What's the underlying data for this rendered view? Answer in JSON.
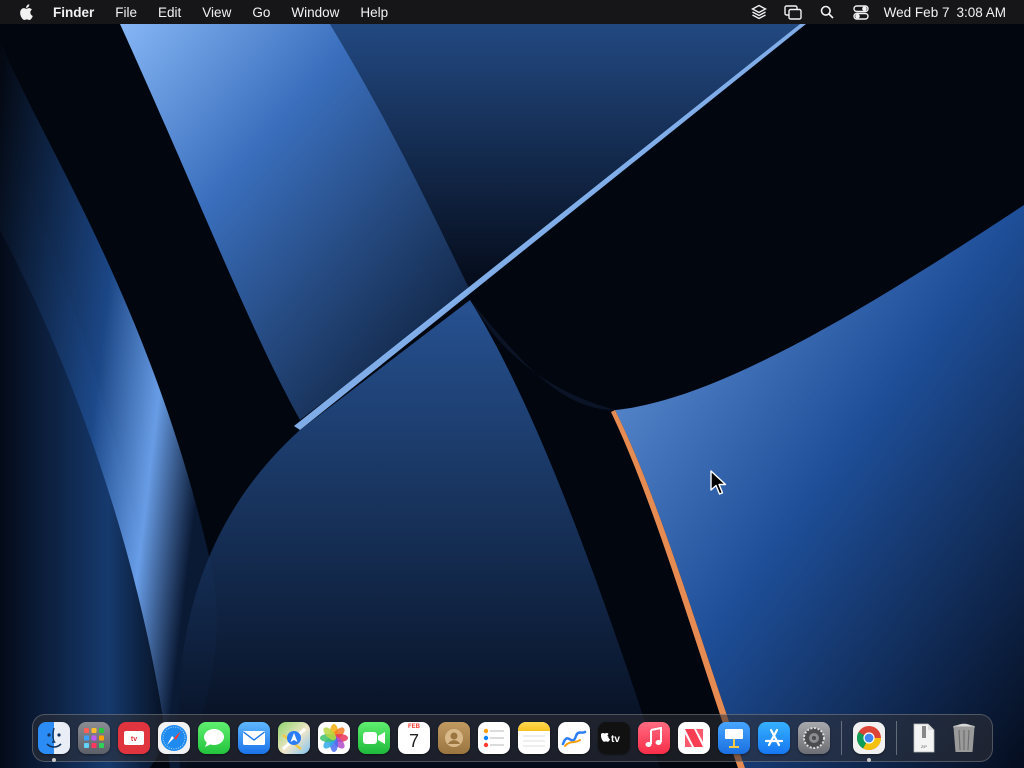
{
  "menubar": {
    "app_name": "Finder",
    "menus": [
      "File",
      "Edit",
      "View",
      "Go",
      "Window",
      "Help"
    ],
    "status_icons": [
      "layers-icon",
      "screen-mirroring-icon",
      "spotlight-search-icon",
      "control-center-icon"
    ],
    "clock": {
      "date": "Wed Feb 7",
      "time": "3:08 AM"
    }
  },
  "dock": {
    "apps": [
      {
        "name": "Finder",
        "icon": "finder-icon",
        "running": true
      },
      {
        "name": "Launchpad",
        "icon": "launchpad-icon",
        "running": false
      },
      {
        "name": "Apple TV Remote",
        "icon": "tv-remote-icon",
        "running": false
      },
      {
        "name": "Safari",
        "icon": "safari-icon",
        "running": false
      },
      {
        "name": "Messages",
        "icon": "messages-icon",
        "running": false
      },
      {
        "name": "Mail",
        "icon": "mail-icon",
        "running": false
      },
      {
        "name": "Maps",
        "icon": "maps-icon",
        "running": false
      },
      {
        "name": "Photos",
        "icon": "photos-icon",
        "running": false
      },
      {
        "name": "FaceTime",
        "icon": "facetime-icon",
        "running": false
      },
      {
        "name": "Calendar",
        "icon": "calendar-icon",
        "running": false,
        "month": "FEB",
        "day": "7"
      },
      {
        "name": "Contacts",
        "icon": "contacts-icon",
        "running": false
      },
      {
        "name": "Reminders",
        "icon": "reminders-icon",
        "running": false
      },
      {
        "name": "Notes",
        "icon": "notes-icon",
        "running": false
      },
      {
        "name": "Freeform",
        "icon": "freeform-icon",
        "running": false
      },
      {
        "name": "TV",
        "icon": "apple-tv-icon",
        "running": false,
        "label": "tv"
      },
      {
        "name": "Music",
        "icon": "music-icon",
        "running": false
      },
      {
        "name": "News",
        "icon": "news-icon",
        "running": false
      },
      {
        "name": "Keynote",
        "icon": "keynote-icon",
        "running": false
      },
      {
        "name": "App Store",
        "icon": "app-store-icon",
        "running": false
      },
      {
        "name": "System Settings",
        "icon": "settings-gear-icon",
        "running": false
      }
    ],
    "recent_apps": [
      {
        "name": "Google Chrome",
        "icon": "chrome-icon",
        "running": true
      }
    ],
    "stack_items": [
      {
        "name": "Archive",
        "icon": "zip-file-icon",
        "label": "ZIP"
      },
      {
        "name": "Trash",
        "icon": "trash-icon"
      }
    ]
  },
  "colors": {
    "menubar_bg": "#18181a",
    "wallpaper_accent": "#4a86d8",
    "wallpaper_dark": "#02060f"
  }
}
